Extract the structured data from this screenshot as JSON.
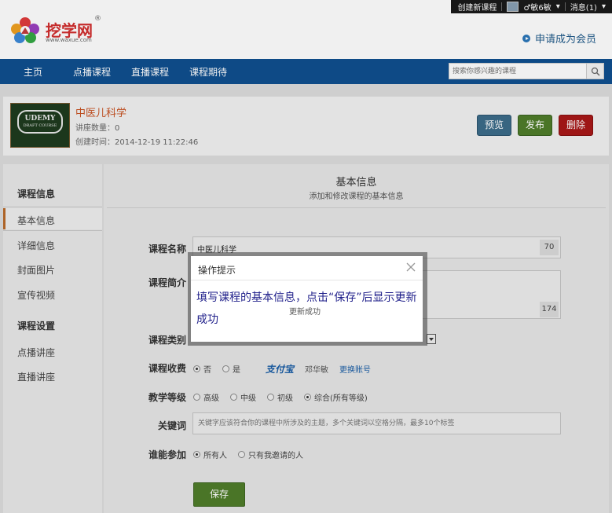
{
  "topbar": {
    "create_course": "创建新课程",
    "username": "♂敏6敏",
    "messages": "消息(1)"
  },
  "header": {
    "logo_text": "挖学网",
    "logo_url": "www.waxue.com",
    "logo_reg": "®",
    "member_link": "申请成为会员"
  },
  "nav": {
    "items": [
      "主页",
      "点播课程",
      "直播课程",
      "课程期待"
    ],
    "search_placeholder": "搜索你感兴趣的课程"
  },
  "course": {
    "thumb_title": "UDEMY",
    "thumb_sub": "DRAFT COURSE",
    "title": "中医儿科学",
    "lecture_count": "讲座数量：0",
    "created": "创建时间：2014-12-19 11:22:46",
    "preview": "预览",
    "publish": "发布",
    "delete": "删除"
  },
  "sidebar": {
    "group1": "课程信息",
    "items1": [
      "基本信息",
      "详细信息",
      "封面图片",
      "宣传视频"
    ],
    "group2": "课程设置",
    "items2": [
      "点播讲座",
      "直播讲座"
    ]
  },
  "form": {
    "section_title": "基本信息",
    "section_sub": "添加和修改课程的基本信息",
    "name_label": "课程名称",
    "name_value": "中医儿科学",
    "name_count": "70",
    "intro_label": "课程简介",
    "intro_count": "174",
    "category_label": "课程类别",
    "fee_label": "课程收费",
    "fee_options": [
      "否",
      "是"
    ],
    "alipay": "支付宝",
    "alipay_name": "邓华敏",
    "change_account": "更换账号",
    "level_label": "教学等级",
    "level_options": [
      "高级",
      "中级",
      "初级",
      "综合(所有等级)"
    ],
    "keyword_label": "关键词",
    "keyword_placeholder": "关键字应该符合你的课程中所涉及的主题，多个关键词以空格分隔，最多10个标签",
    "access_label": "谁能参加",
    "access_options": [
      "所有人",
      "只有我邀请的人"
    ],
    "save": "保存"
  },
  "modal": {
    "title": "操作提示",
    "message": "填写课程的基本信息，点击“保存”后显示更新成功",
    "sub": "更新成功"
  }
}
